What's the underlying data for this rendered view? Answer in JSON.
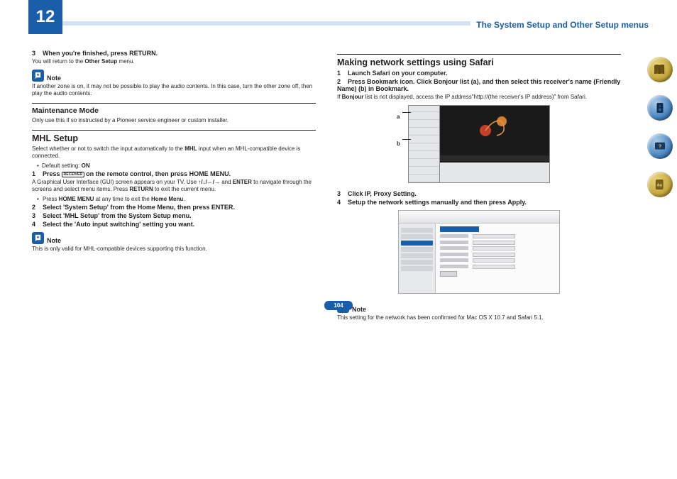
{
  "header": {
    "chapter": "12",
    "title": "The System Setup and Other Setup menus"
  },
  "left": {
    "finished": {
      "num": "3",
      "text": "When you're finished, press RETURN."
    },
    "finished_body_a": "You will return to the ",
    "finished_body_b": "Other Setup",
    "finished_body_c": " menu.",
    "note1": "If another zone is on, it may not be possible to play the audio contents. In this case, turn the other zone off, then play the audio contents.",
    "maintenance_title": "Maintenance Mode",
    "maintenance_body": "Only use this if so instructed by a Pioneer service engineer or custom installer.",
    "mhl_title": "MHL Setup",
    "mhl_body_a": "Select whether or not to switch the input automatically to the ",
    "mhl_body_b": "MHL",
    "mhl_body_c": " input when an MHL-compatible device is connected.",
    "mhl_default_a": "Default setting: ",
    "mhl_default_b": "ON",
    "mhl_s1": {
      "num": "1",
      "a": "Press ",
      "btn": "RECEIVER",
      "b": " on the remote control, then press HOME MENU."
    },
    "mhl_s1_body_a": "A Graphical User Interface (GUI) screen appears on your TV. Use ",
    "mhl_s1_arrows": "↑/↓/←/→",
    "mhl_s1_body_b": " and ",
    "mhl_s1_enter": "ENTER",
    "mhl_s1_body_c": " to navigate through the screens and select menu items. Press ",
    "mhl_s1_return": "RETURN",
    "mhl_s1_body_d": " to exit the current menu.",
    "mhl_bullet_a": "Press ",
    "mhl_bullet_b": "HOME MENU",
    "mhl_bullet_c": " at any time to exit the ",
    "mhl_bullet_d": "Home Menu",
    "mhl_bullet_e": ".",
    "mhl_s2": {
      "num": "2",
      "text": "Select 'System Setup' from the Home Menu, then press ENTER."
    },
    "mhl_s3": {
      "num": "3",
      "text": "Select 'MHL Setup' from the System Setup menu."
    },
    "mhl_s4": {
      "num": "4",
      "text": "Select the 'Auto input switching' setting you want."
    },
    "note2": "This is only valid for MHL-compatible devices supporting this function."
  },
  "right": {
    "title": "Making network settings using Safari",
    "s1": {
      "num": "1",
      "text": "Launch Safari on your computer."
    },
    "s2": {
      "num": "2",
      "text": "Press Bookmark icon. Click Bonjour list (a), and then select this receiver's name (Friendly Name) (b) in Bookmark."
    },
    "s2_body_a": "If ",
    "s2_body_b": "Bonjour",
    "s2_body_c": " list is not displayed, access the IP address\"http://(the receiver's IP address)\" from Safari.",
    "label_a": "a",
    "label_b": "b",
    "s3": {
      "num": "3",
      "text": "Click IP, Proxy Setting."
    },
    "s4": {
      "num": "4",
      "text": "Setup the network settings manually and then press Apply."
    },
    "note3": "This setting for the network has been confirmed for Mac OS X 10.7 and Safari 5.1."
  },
  "note_label": "Note",
  "page_num": "104"
}
